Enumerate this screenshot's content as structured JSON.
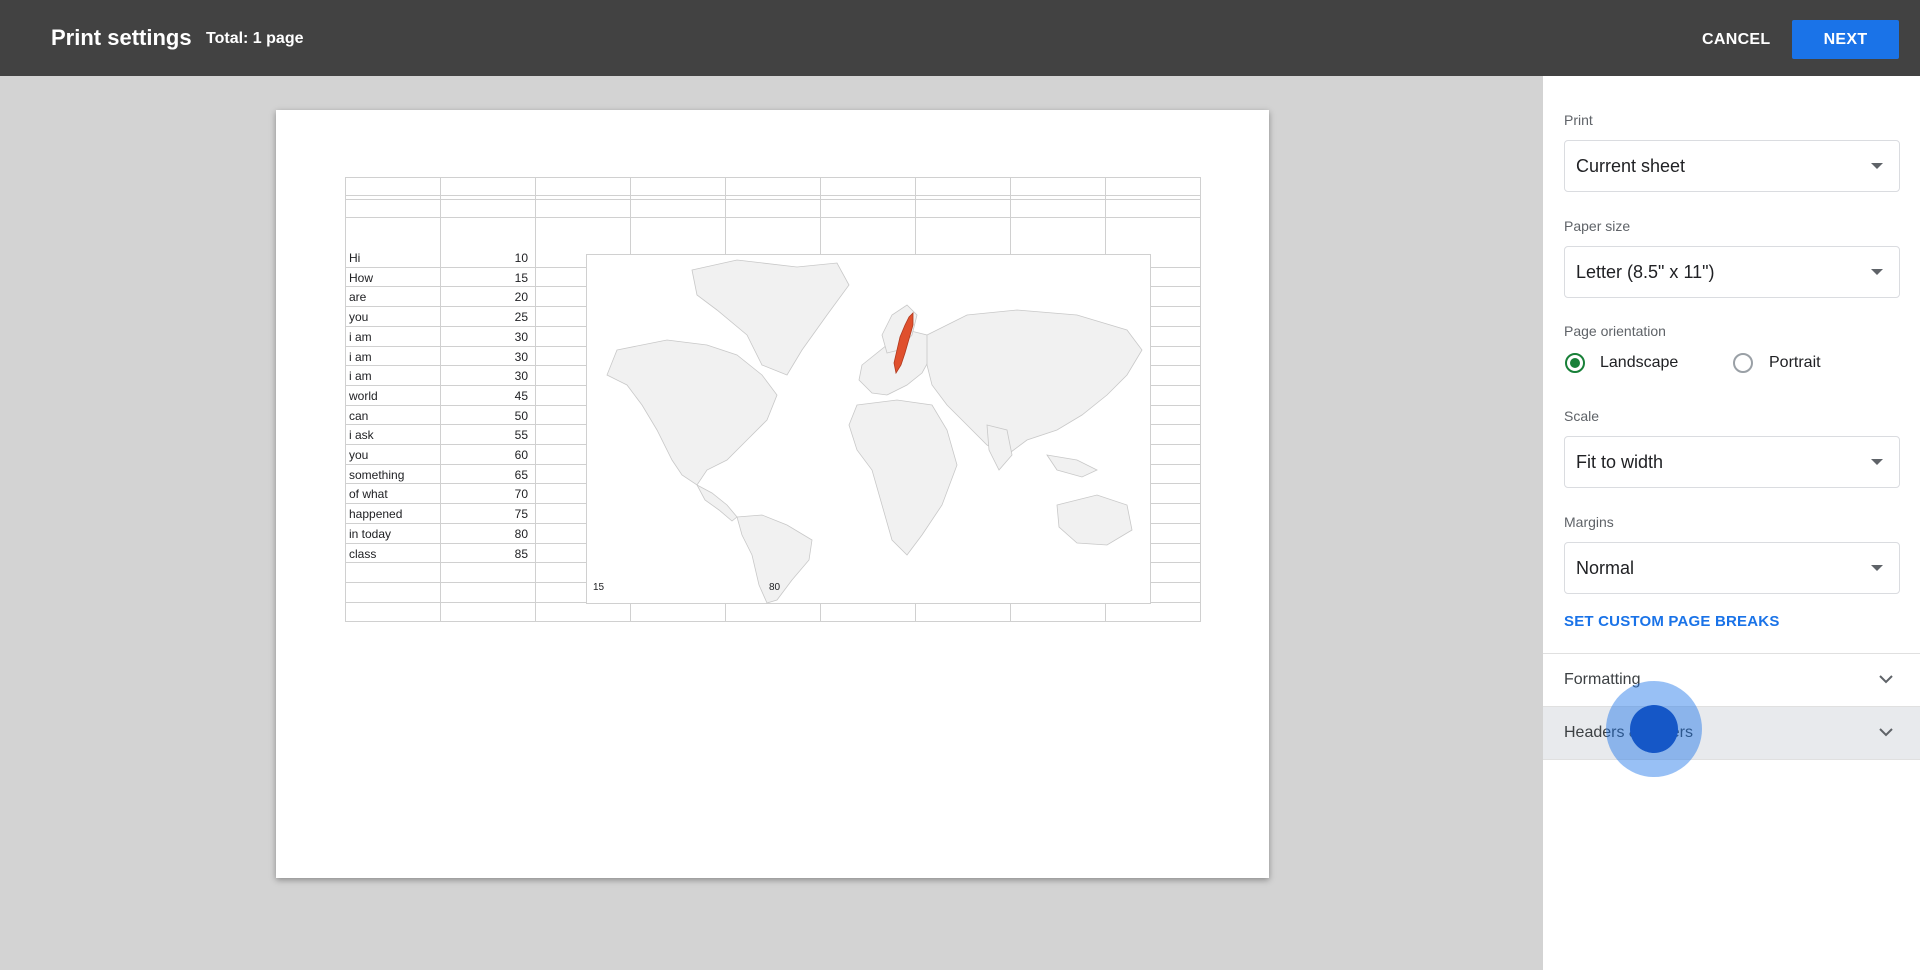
{
  "header": {
    "title": "Print settings",
    "total": "Total: 1 page",
    "cancel_label": "CANCEL",
    "next_label": "NEXT"
  },
  "preview": {
    "rows": [
      {
        "label": "Hi",
        "value": "10"
      },
      {
        "label": "How",
        "value": "15"
      },
      {
        "label": "are",
        "value": "20"
      },
      {
        "label": "you",
        "value": "25"
      },
      {
        "label": "i am",
        "value": "30"
      },
      {
        "label": "i am",
        "value": "30"
      },
      {
        "label": "i am",
        "value": "30"
      },
      {
        "label": "world",
        "value": "45"
      },
      {
        "label": "can",
        "value": "50"
      },
      {
        "label": "i ask",
        "value": "55"
      },
      {
        "label": "you",
        "value": "60"
      },
      {
        "label": "something",
        "value": "65"
      },
      {
        "label": "of what",
        "value": "70"
      },
      {
        "label": "happened",
        "value": "75"
      },
      {
        "label": "in today",
        "value": "80"
      },
      {
        "label": "class",
        "value": "85"
      }
    ],
    "map": {
      "legend_min": "15",
      "legend_max": "80",
      "highlight_color": "#e0502d"
    }
  },
  "panel": {
    "print": {
      "label": "Print",
      "value": "Current sheet"
    },
    "paper_size": {
      "label": "Paper size",
      "value": "Letter (8.5\" x 11\")"
    },
    "orientation": {
      "label": "Page orientation",
      "landscape": "Landscape",
      "portrait": "Portrait",
      "selected": "Landscape"
    },
    "scale": {
      "label": "Scale",
      "value": "Fit to width"
    },
    "margins": {
      "label": "Margins",
      "value": "Normal"
    },
    "custom_breaks": "SET CUSTOM PAGE BREAKS",
    "formatting": "Formatting",
    "headers_footers": "Headers & footers"
  },
  "colors": {
    "header_bg": "#424242",
    "accent": "#1a73e8",
    "radio_selected": "#188038"
  }
}
